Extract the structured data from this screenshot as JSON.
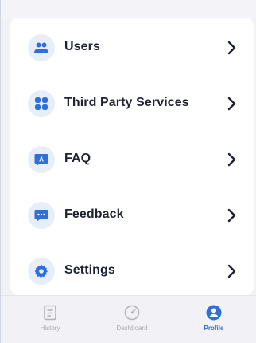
{
  "menu": {
    "items": [
      {
        "label": "Users",
        "icon": "users-icon"
      },
      {
        "label": "Third Party Services",
        "icon": "grid-icon"
      },
      {
        "label": "FAQ",
        "icon": "faq-icon"
      },
      {
        "label": "Feedback",
        "icon": "chat-bubble-icon"
      },
      {
        "label": "Settings",
        "icon": "gear-icon"
      }
    ]
  },
  "tabbar": {
    "tabs": [
      {
        "label": "History",
        "icon": "history-icon",
        "active": false
      },
      {
        "label": "Dashboard",
        "icon": "dashboard-icon",
        "active": false
      },
      {
        "label": "Profile",
        "icon": "profile-icon",
        "active": true
      }
    ]
  },
  "colors": {
    "accent": "#2f6fdc",
    "icon_bg": "#e8eef8",
    "text": "#1f2330",
    "inactive": "#a8aab2",
    "page_bg": "#f2f2f6"
  }
}
